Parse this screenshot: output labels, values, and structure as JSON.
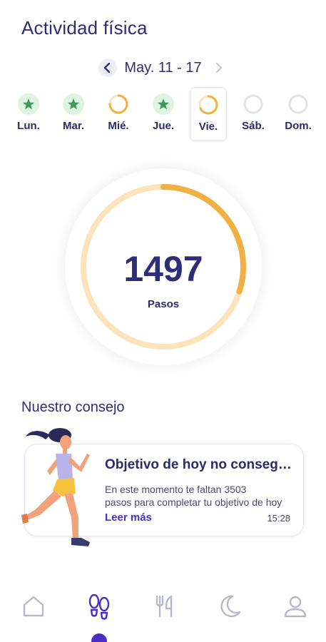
{
  "header": {
    "title": "Actividad física"
  },
  "week": {
    "label": "May. 11 - 17",
    "prev_icon": "chevron-left-icon",
    "next_icon": "chevron-right-icon"
  },
  "days": [
    {
      "label": "Lun.",
      "status": "completed"
    },
    {
      "label": "Mar.",
      "status": "completed"
    },
    {
      "label": "Mié.",
      "status": "partial",
      "progress": 0.75
    },
    {
      "label": "Jue.",
      "status": "completed"
    },
    {
      "label": "Vie.",
      "status": "partial",
      "progress": 0.68,
      "selected": true
    },
    {
      "label": "Sáb.",
      "status": "empty"
    },
    {
      "label": "Dom.",
      "status": "empty"
    }
  ],
  "steps": {
    "value": "1497",
    "unit": "Pasos",
    "progress": 0.3
  },
  "tip": {
    "section_title": "Nuestro consejo",
    "title": "Objetivo de hoy no conseguido",
    "body_line1": "En este momento te faltan 3503",
    "body_line2": "pasos para completar tu objetivo de hoy",
    "link": "Leer más",
    "time": "15:28"
  },
  "bottom_nav": {
    "items": [
      "home-icon",
      "footsteps-icon",
      "fork-knife-icon",
      "moon-icon",
      "user-icon"
    ],
    "active": 1
  },
  "colors": {
    "primary": "#2f2d78",
    "accent": "#4b2ec7",
    "orange": "#f0b043",
    "orange_light": "#fbe3bc",
    "green": "#3e9a58",
    "green_light": "#dff3e3",
    "gray_ring": "#e1e1e8",
    "icon_gray": "#b8b8cc"
  }
}
